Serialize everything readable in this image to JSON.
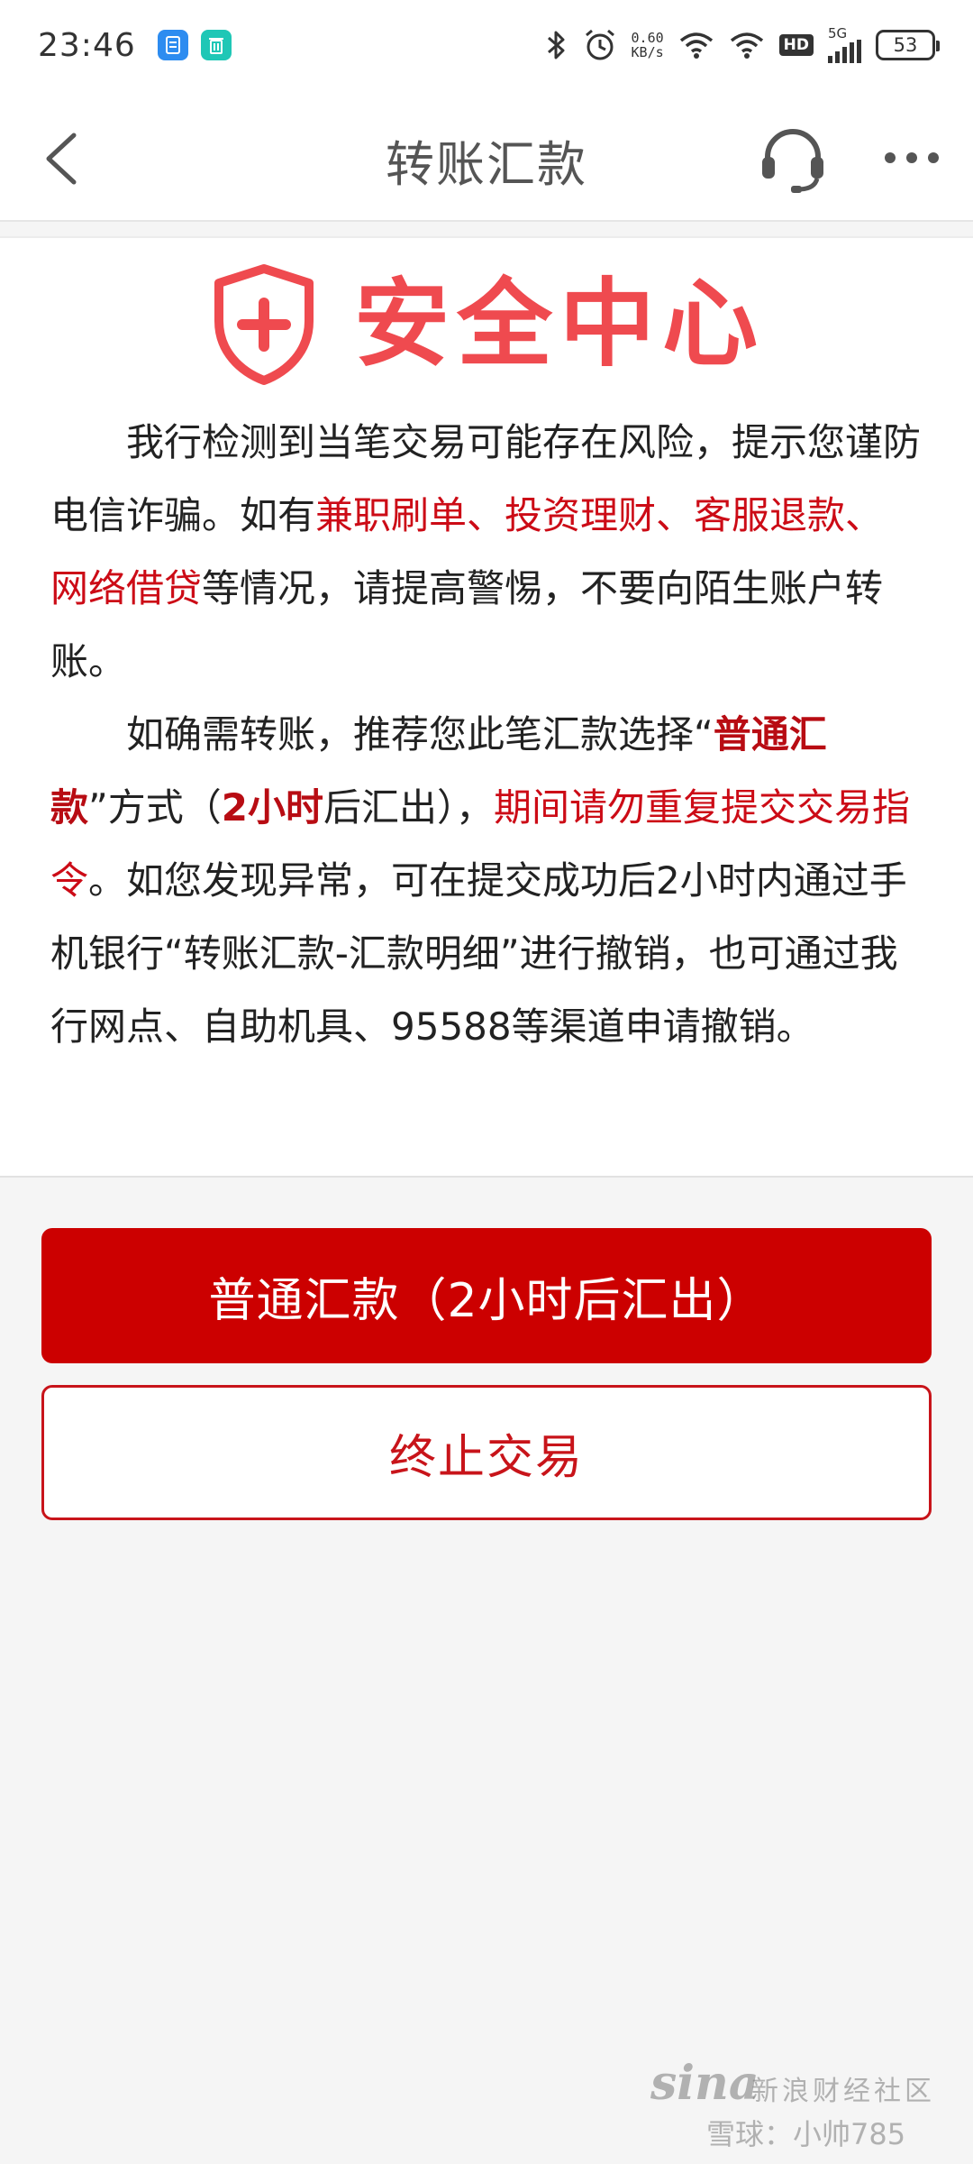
{
  "status_bar": {
    "time": "23:46",
    "net_speed_value": "0.60",
    "net_speed_unit": "KB/s",
    "hd": "HD",
    "network": "5G",
    "battery": "53"
  },
  "nav": {
    "title": "转账汇款"
  },
  "notice": {
    "title": "安全中心",
    "p1": {
      "t1": "我行检测到当笔交易可能存在风险，提示您谨防电信诈骗。如有",
      "t2": "兼职刷单、投资理财、客服退款、网络借贷",
      "t3": "等情况，请提高警惕，不要向陌生账户转账。"
    },
    "p2": {
      "t1": "如确需转账，推荐您此笔汇款选择“",
      "t2": "普通汇款",
      "t3": "”方式（",
      "t4": "2小时",
      "t5": "后汇出），",
      "t6": "期间请勿重复提交交易指令",
      "t7": "。如您发现异常，可在提交成功后2小时内通过手机银行“转账汇款-汇款明细”进行撤销，也可通过我行网点、自助机具、95588等渠道申请撤销。"
    }
  },
  "buttons": {
    "primary_label": "普通汇款（2小时后汇出）",
    "secondary_label": "终止交易"
  },
  "watermark": {
    "logo": "sina",
    "site": "新浪财经社区",
    "user": "雪球：小帅785"
  },
  "colors": {
    "accent_red": "#cc0000",
    "title_red": "#ef4a4f",
    "highlight_red": "#cc0b16"
  }
}
